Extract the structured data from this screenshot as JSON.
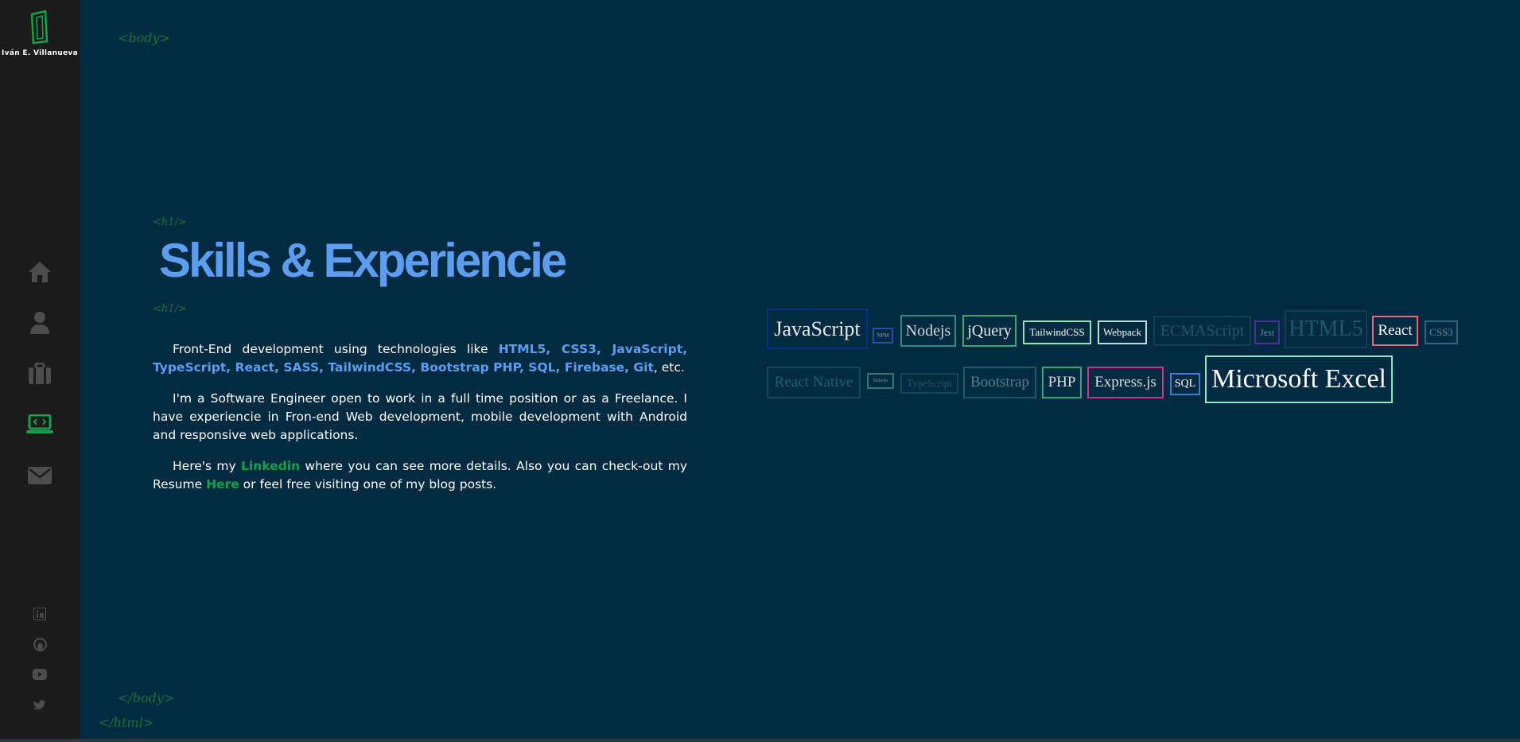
{
  "sidebar": {
    "logo_name": "Iván E. Villanueva",
    "nav": [
      {
        "name": "home-icon"
      },
      {
        "name": "user-icon"
      },
      {
        "name": "briefcase-icon"
      },
      {
        "name": "laptop-code-icon",
        "active": true
      },
      {
        "name": "envelope-icon"
      }
    ],
    "social": [
      {
        "name": "linkedin-icon"
      },
      {
        "name": "github-icon"
      },
      {
        "name": "youtube-icon"
      },
      {
        "name": "twitter-icon"
      }
    ]
  },
  "decorations": {
    "body_open": "<body>",
    "h1_open": "<h1/>",
    "h1_close": "<h1/>",
    "body_close": "</body>",
    "html_close": "</html>"
  },
  "main": {
    "title": "Skills & Experiencie",
    "p1": {
      "intro": "Front-End development using technologies like ",
      "techs": "HTML5, CSS3, JavaScript, TypeScript, React, SASS, TailwindCSS, Bootstrap PHP, SQL, Firebase, Git",
      "outro": ", etc."
    },
    "p2": "I'm a Software Engineer open to work in a full time position or as a Freelance. I have experiencie in Fron-end Web development, mobile development with Android and responsive web applications.",
    "p3": {
      "a": "Here's my ",
      "linkedin": "Linkedin",
      "b": " where you can see more details. Also you can check-out my Resume ",
      "here": "Here",
      "c": " or feel free visiting one of my blog posts."
    }
  },
  "skills_cloud": [
    {
      "label": "JavaScript",
      "color": "#0d2e8c",
      "text": "#e8e8e8",
      "size": 26
    },
    {
      "label": "NPM",
      "color": "#2a4bb0",
      "text": "#8da0c8",
      "size": 7
    },
    {
      "label": "Nodejs",
      "color": "#2e8a7a",
      "text": "#cfd7d8",
      "size": 20
    },
    {
      "label": "jQuery",
      "color": "#3aa86a",
      "text": "#e8e8e8",
      "size": 20
    },
    {
      "label": "TailwindCSS",
      "color": "#8ae8b0",
      "text": "#ffffff",
      "size": 13
    },
    {
      "label": "Webpack",
      "color": "#b8e0d8",
      "text": "#ffffff",
      "size": 13
    },
    {
      "label": "ECMAScript",
      "color": "#0f4055",
      "text": "#1d5870",
      "size": 20
    },
    {
      "label": "Jest",
      "color": "#4b2ea0",
      "text": "#6a8aa8",
      "size": 12
    },
    {
      "label": "HTML5",
      "color": "#0f4055",
      "text": "#1d5870",
      "size": 28
    },
    {
      "label": "React",
      "color": "#e86a7a",
      "text": "#ffffff",
      "size": 19
    },
    {
      "label": "CSS3",
      "color": "#2a6a80",
      "text": "#5f8ea0",
      "size": 13
    },
    {
      "label": "React Native",
      "color": "#114a58",
      "text": "#1f6070",
      "size": 19
    },
    {
      "label": "Babeljs",
      "color": "#2a7a70",
      "text": "#6a9a98",
      "size": 6
    },
    {
      "label": "TypeScript",
      "color": "#0f4a50",
      "text": "#1d5a62",
      "size": 13
    },
    {
      "label": "Bootstrap",
      "color": "#1f5a60",
      "text": "#4f8088",
      "size": 19
    },
    {
      "label": "PHP",
      "color": "#2ea878",
      "text": "#d8dee0",
      "size": 19
    },
    {
      "label": "Express.js",
      "color": "#c03a8a",
      "text": "#d8dee0",
      "size": 19
    },
    {
      "label": "SQL",
      "color": "#3a7ad0",
      "text": "#ffffff",
      "size": 14
    },
    {
      "label": "Microsoft Excel",
      "color": "#8ae8c0",
      "text": "#ffffff",
      "size": 34
    }
  ],
  "colors": {
    "background": "#022b41",
    "sidebar": "#1b1b1b",
    "accent_blue": "#5c9df0",
    "accent_green": "#12a24c",
    "icon_gray": "#4d4d4e"
  }
}
